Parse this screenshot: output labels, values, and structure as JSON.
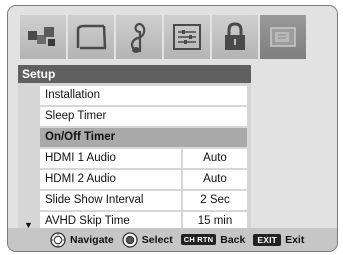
{
  "tabs": [
    {
      "icon": "picture-icon"
    },
    {
      "icon": "screen-icon"
    },
    {
      "icon": "music-note-icon"
    },
    {
      "icon": "applications-icon"
    },
    {
      "icon": "lock-icon"
    },
    {
      "icon": "setup-icon",
      "active": true
    }
  ],
  "menu": {
    "title": "Setup",
    "items": [
      {
        "label": "Installation",
        "value": null
      },
      {
        "label": "Sleep Timer",
        "value": null
      },
      {
        "label": "On/Off Timer",
        "value": null,
        "selected": true
      },
      {
        "label": "HDMI 1 Audio",
        "value": "Auto"
      },
      {
        "label": "HDMI 2 Audio",
        "value": "Auto"
      },
      {
        "label": "Slide Show Interval",
        "value": "2 Sec"
      },
      {
        "label": "AVHD Skip Time",
        "value": "15 min"
      }
    ],
    "scroll_indicator": "▼"
  },
  "footer": {
    "navigate_label": "Navigate",
    "select_label": "Select",
    "ch_rtn_key": "CH RTN",
    "back_label": "Back",
    "exit_key": "EXIT",
    "exit_label": "Exit"
  },
  "colors": {
    "title_bar": "#606060",
    "selected_row": "#a9a9a9",
    "panel": "#e2e2e2"
  }
}
